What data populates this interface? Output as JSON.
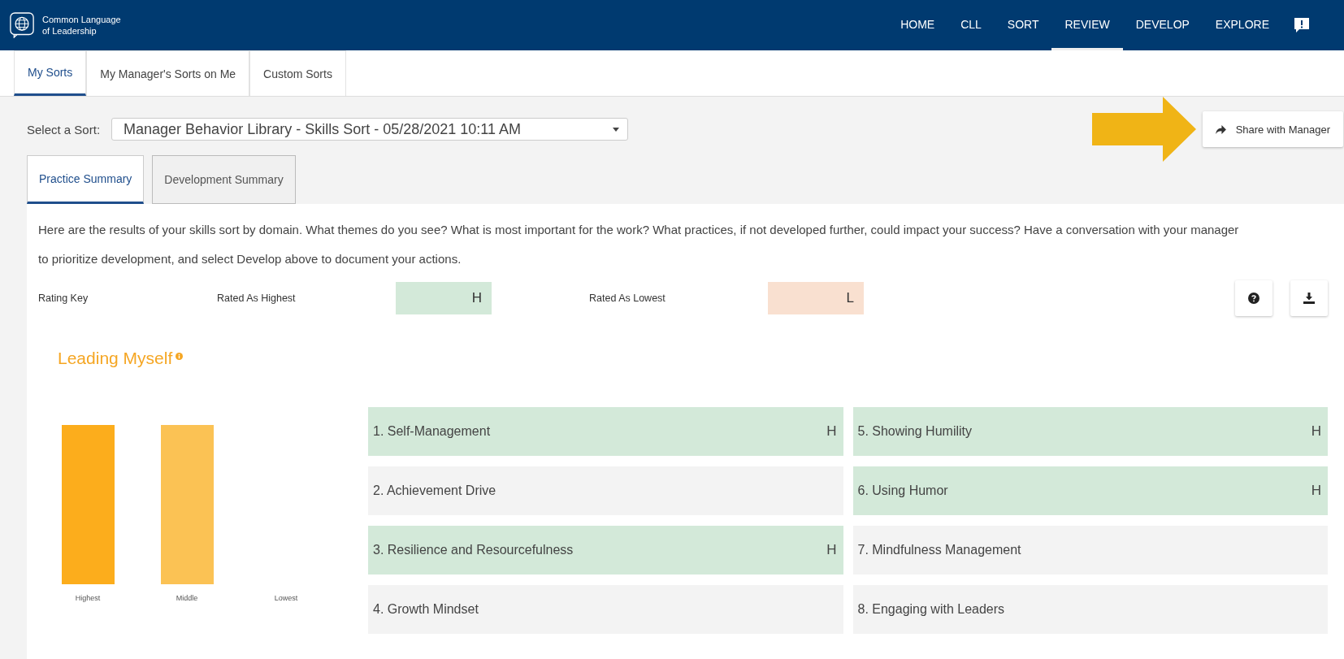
{
  "header": {
    "logo_text": "Common Language of Leadership",
    "nav": [
      {
        "label": "HOME",
        "selected": false
      },
      {
        "label": "CLL",
        "selected": false
      },
      {
        "label": "SORT",
        "selected": false
      },
      {
        "label": "REVIEW",
        "selected": true
      },
      {
        "label": "DEVELOP",
        "selected": false
      },
      {
        "label": "EXPLORE",
        "selected": false
      }
    ]
  },
  "tabs": [
    {
      "label": "My Sorts",
      "selected": true
    },
    {
      "label": "My Manager's Sorts on Me",
      "selected": false
    },
    {
      "label": "Custom Sorts",
      "selected": false
    }
  ],
  "sort_select": {
    "label": "Select a Sort:",
    "value": "Manager Behavior Library - Skills Sort - 05/28/2021 10:11 AM"
  },
  "share_button": "Share with Manager",
  "summary_tabs": [
    {
      "label": "Practice Summary",
      "selected": true
    },
    {
      "label": "Development Summary",
      "selected": false
    }
  ],
  "intro": "Here are the results of your skills sort by domain. What themes do you see? What is most important for the work? What practices, if not developed further, could impact your success? Have a conversation with your manager to prioritize development, and select Develop above to document your actions.",
  "rating_key": {
    "label": "Rating Key",
    "entries": [
      {
        "label": "Rated As Highest",
        "mark": "H",
        "kind": "highest"
      },
      {
        "label": "Rated As Lowest",
        "mark": "L",
        "kind": "lowest"
      }
    ]
  },
  "domain": {
    "title": "Leading Myself",
    "bars": [
      {
        "label": "Highest",
        "kind": "high"
      },
      {
        "label": "Middle",
        "kind": "mid"
      },
      {
        "label": "Lowest",
        "kind": "none"
      }
    ],
    "skills": [
      {
        "label": "1. Self-Management",
        "kind": "highest",
        "mark": "H"
      },
      {
        "label": "2. Achievement Drive",
        "kind": "middle"
      },
      {
        "label": "3. Resilience and Resourcefulness",
        "kind": "highest",
        "mark": "H"
      },
      {
        "label": "4. Growth Mindset",
        "kind": "middle"
      },
      {
        "label": "5. Showing Humility",
        "kind": "highest",
        "mark": "H"
      },
      {
        "label": "6. Using Humor",
        "kind": "highest",
        "mark": "H"
      },
      {
        "label": "7. Mindfulness Management",
        "kind": "middle"
      },
      {
        "label": "8. Engaging with Leaders",
        "kind": "middle"
      }
    ]
  }
}
